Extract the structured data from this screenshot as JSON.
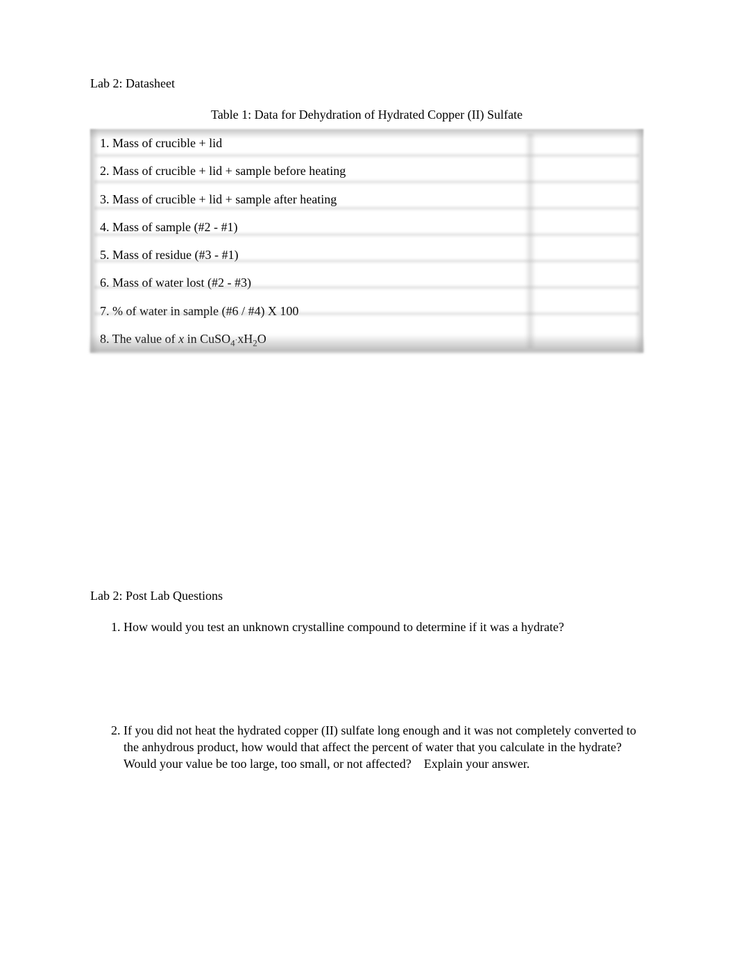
{
  "sheet_title": "Lab 2: Datasheet",
  "table_title": "Table 1: Data for Dehydration of Hydrated Copper (II) Sulfate",
  "rows": [
    {
      "label": "1. Mass of crucible + lid",
      "value": ""
    },
    {
      "label": "2. Mass of crucible + lid + sample before heating",
      "value": ""
    },
    {
      "label": "3. Mass of crucible + lid + sample after heating",
      "value": ""
    },
    {
      "label": "4. Mass of sample (#2 - #1)",
      "value": ""
    },
    {
      "label": "5. Mass of residue (#3 - #1)",
      "value": ""
    },
    {
      "label": "6. Mass of water lost (#2 - #3)",
      "value": ""
    },
    {
      "label": "7. % of water in sample (#6 / #4) X 100",
      "value": ""
    }
  ],
  "row8": {
    "prefix": "8. The value of ",
    "var": "x",
    "mid": " in CuSO",
    "sub1": "4",
    "dot": "·",
    "xh": "xH",
    "sub2": "2",
    "o": "O",
    "value": ""
  },
  "postlab_title": "Lab 2: Post Lab Questions",
  "q1": "How would you test an unknown crystalline compound to determine if it was a hydrate?",
  "q2": {
    "l1": "If you did not heat the hydrated copper (II) sulfate long enough and it was not completely ",
    "l2": "converted to the anhydrous product, how would that affect the percent of water that you ",
    "l3a": "calculate in the hydrate? Would your value be too large, too small, or not affected?",
    "l3b": "Explain your ",
    "l4": "answer."
  }
}
